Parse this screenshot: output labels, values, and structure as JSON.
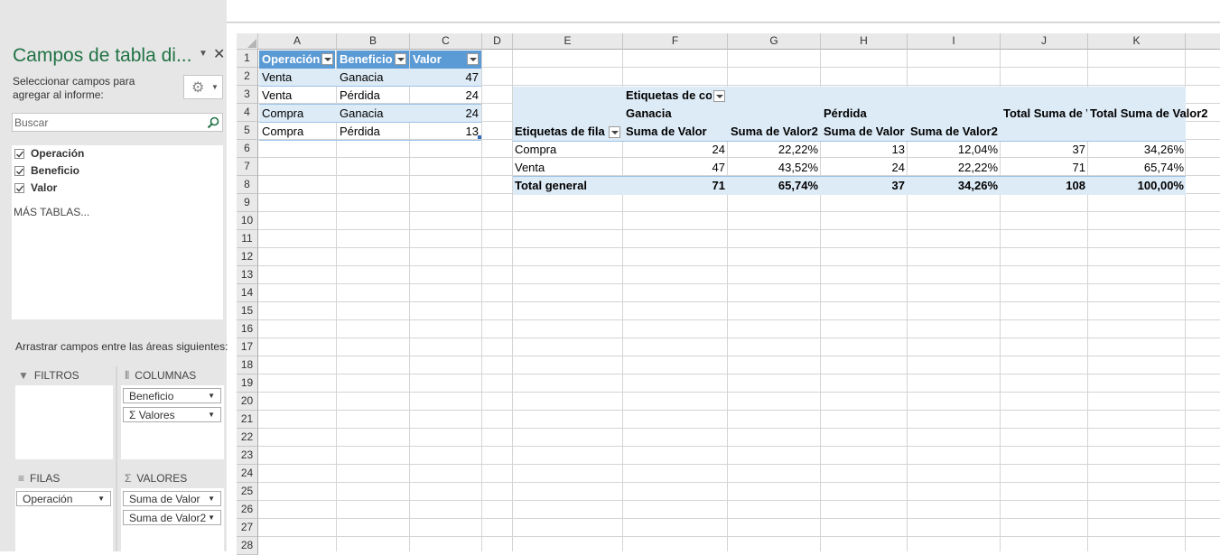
{
  "panel": {
    "title": "Campos de tabla di...",
    "description": "Seleccionar campos para agregar al informe:",
    "search_placeholder": "Buscar",
    "fields": [
      "Operación",
      "Beneficio",
      "Valor"
    ],
    "more_tables": "MÁS TABLAS...",
    "drag_text": "Arrastrar campos entre las áreas siguientes:",
    "areas": {
      "filters_label": "FILTROS",
      "columns_label": "COLUMNAS",
      "rows_label": "FILAS",
      "values_label": "VALORES",
      "columns_items": [
        "Beneficio",
        "Valores"
      ],
      "rows_items": [
        "Operación"
      ],
      "values_items": [
        "Suma de Valor",
        "Suma de Valor2"
      ]
    }
  },
  "sheet": {
    "columns": [
      "A",
      "B",
      "C",
      "D",
      "E",
      "F",
      "G",
      "H",
      "I",
      "J",
      "K"
    ],
    "row_numbers": [
      "1",
      "2",
      "3",
      "4",
      "5",
      "6",
      "7",
      "8",
      "9",
      "10",
      "11",
      "12",
      "13",
      "14",
      "15",
      "16",
      "17",
      "18",
      "19",
      "20",
      "21",
      "22",
      "23",
      "24",
      "25",
      "26",
      "27",
      "28"
    ],
    "table": {
      "headers": [
        "Operación",
        "Beneficio",
        "Valor"
      ],
      "rows": [
        [
          "Venta",
          "Ganacia",
          "47"
        ],
        [
          "Venta",
          "Pérdida",
          "24"
        ],
        [
          "Compra",
          "Ganacia",
          "24"
        ],
        [
          "Compra",
          "Pérdida",
          "13"
        ]
      ]
    },
    "pivot": {
      "col_labels": "Etiquetas de columna",
      "row_labels": "Etiquetas de fila",
      "group1": "Ganacia",
      "group2": "Pérdida",
      "total_sum_value": "Total Suma de Valor",
      "total_sum_value2": "Total Suma de Valor2",
      "measure1": "Suma de Valor",
      "measure2": "Suma de Valor2",
      "rows": [
        [
          "Compra",
          "24",
          "22,22%",
          "13",
          "12,04%",
          "37",
          "34,26%"
        ],
        [
          "Venta",
          "47",
          "43,52%",
          "24",
          "22,22%",
          "71",
          "65,74%"
        ]
      ],
      "total": [
        "Total general",
        "71",
        "65,74%",
        "37",
        "34,26%",
        "108",
        "100,00%"
      ]
    }
  },
  "colors": {
    "accent": "#217346",
    "table_header": "#5b9bd5",
    "band": "#ddebf7"
  }
}
